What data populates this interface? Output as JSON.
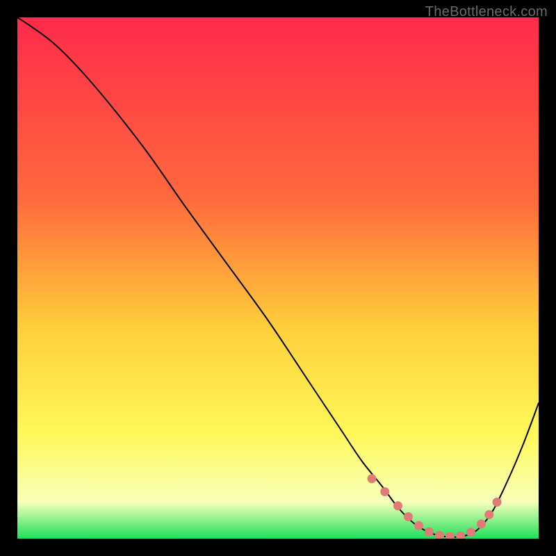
{
  "watermark": "TheBottleneck.com",
  "colors": {
    "black": "#000000",
    "curve": "#000000",
    "dot": "#e07b78",
    "grad_top": "#ff2a4b",
    "grad_mid1": "#ff6a3c",
    "grad_mid2": "#ffd03a",
    "grad_mid3": "#fff85a",
    "grad_mid4": "#f6ffba",
    "grad_bottom": "#1fe05a"
  },
  "chart_data": {
    "type": "line",
    "title": "",
    "xlabel": "",
    "ylabel": "",
    "xlim": [
      0,
      100
    ],
    "ylim": [
      0,
      100
    ],
    "curve": {
      "x": [
        0,
        3,
        7,
        12,
        18,
        25,
        32,
        40,
        48,
        56,
        62,
        66,
        70,
        73,
        76,
        79,
        82,
        85,
        88,
        91,
        94,
        97,
        100
      ],
      "y": [
        100,
        98,
        95,
        90,
        83,
        74,
        64,
        53,
        42,
        30,
        21,
        15,
        10,
        6,
        3,
        1.2,
        0.4,
        0.4,
        1.5,
        5,
        11,
        18,
        26
      ]
    },
    "markers": {
      "x": [
        68,
        70.5,
        73,
        75,
        77,
        79,
        81,
        83,
        85,
        87,
        89,
        90.5,
        92
      ],
      "y": [
        11.5,
        9,
        6.3,
        4.2,
        2.5,
        1.3,
        0.6,
        0.4,
        0.5,
        1.2,
        2.8,
        4.6,
        7
      ]
    }
  }
}
